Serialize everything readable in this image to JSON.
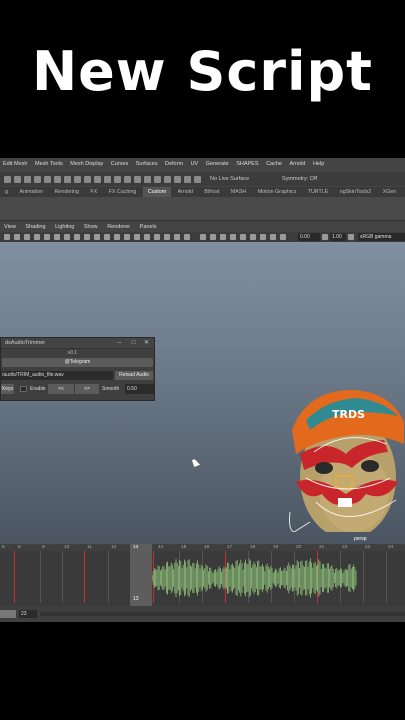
{
  "headline": "New Script",
  "menubar": [
    "Edit Mesh",
    "Mesh Tools",
    "Mesh Display",
    "Curves",
    "Surfaces",
    "Deform",
    "UV",
    "Generate",
    "SHAPES",
    "Cache",
    "Arnold",
    "Help"
  ],
  "statusline": {
    "live_surface": "No Live Surface",
    "symmetry": "Symmetry: Off"
  },
  "shelf_tabs": [
    "g",
    "Animation",
    "Rendering",
    "FX",
    "FX Caching",
    "Custom",
    "Arnold",
    "Bifrost",
    "MASH",
    "Motion Graphics",
    "TURTLE",
    "ngSkinTools2",
    "XGen"
  ],
  "shelf_active": "Custom",
  "panel_menu": [
    "View",
    "Shading",
    "Lighting",
    "Show",
    "Renderer",
    "Panels"
  ],
  "panel_toolbar": {
    "value1": "0.00",
    "value2": "1.00",
    "color_space": "sRGB gamma"
  },
  "tool_window": {
    "title": "dsAudioTrimmer",
    "version": "v0.1",
    "telegram_button": "@Telegram",
    "audio_path": "/audio/TRIM_audio_file.wav",
    "reload_button": "Reload Audio",
    "keys_button": "Keys",
    "enable_label": "Enable",
    "prev_button": "<<",
    "next_button": ">>",
    "smooth_label": "Smooth",
    "smooth_value": "0.50"
  },
  "viewport": {
    "camera_label": "persp"
  },
  "timeline": {
    "tick_labels": [
      "6",
      "8",
      "9",
      "10",
      "11",
      "12",
      "13",
      "14",
      "15",
      "16",
      "17",
      "18",
      "19",
      "20",
      "21",
      "22",
      "23",
      "24"
    ],
    "current_frame": "13"
  },
  "range": {
    "end_frame": "23"
  }
}
